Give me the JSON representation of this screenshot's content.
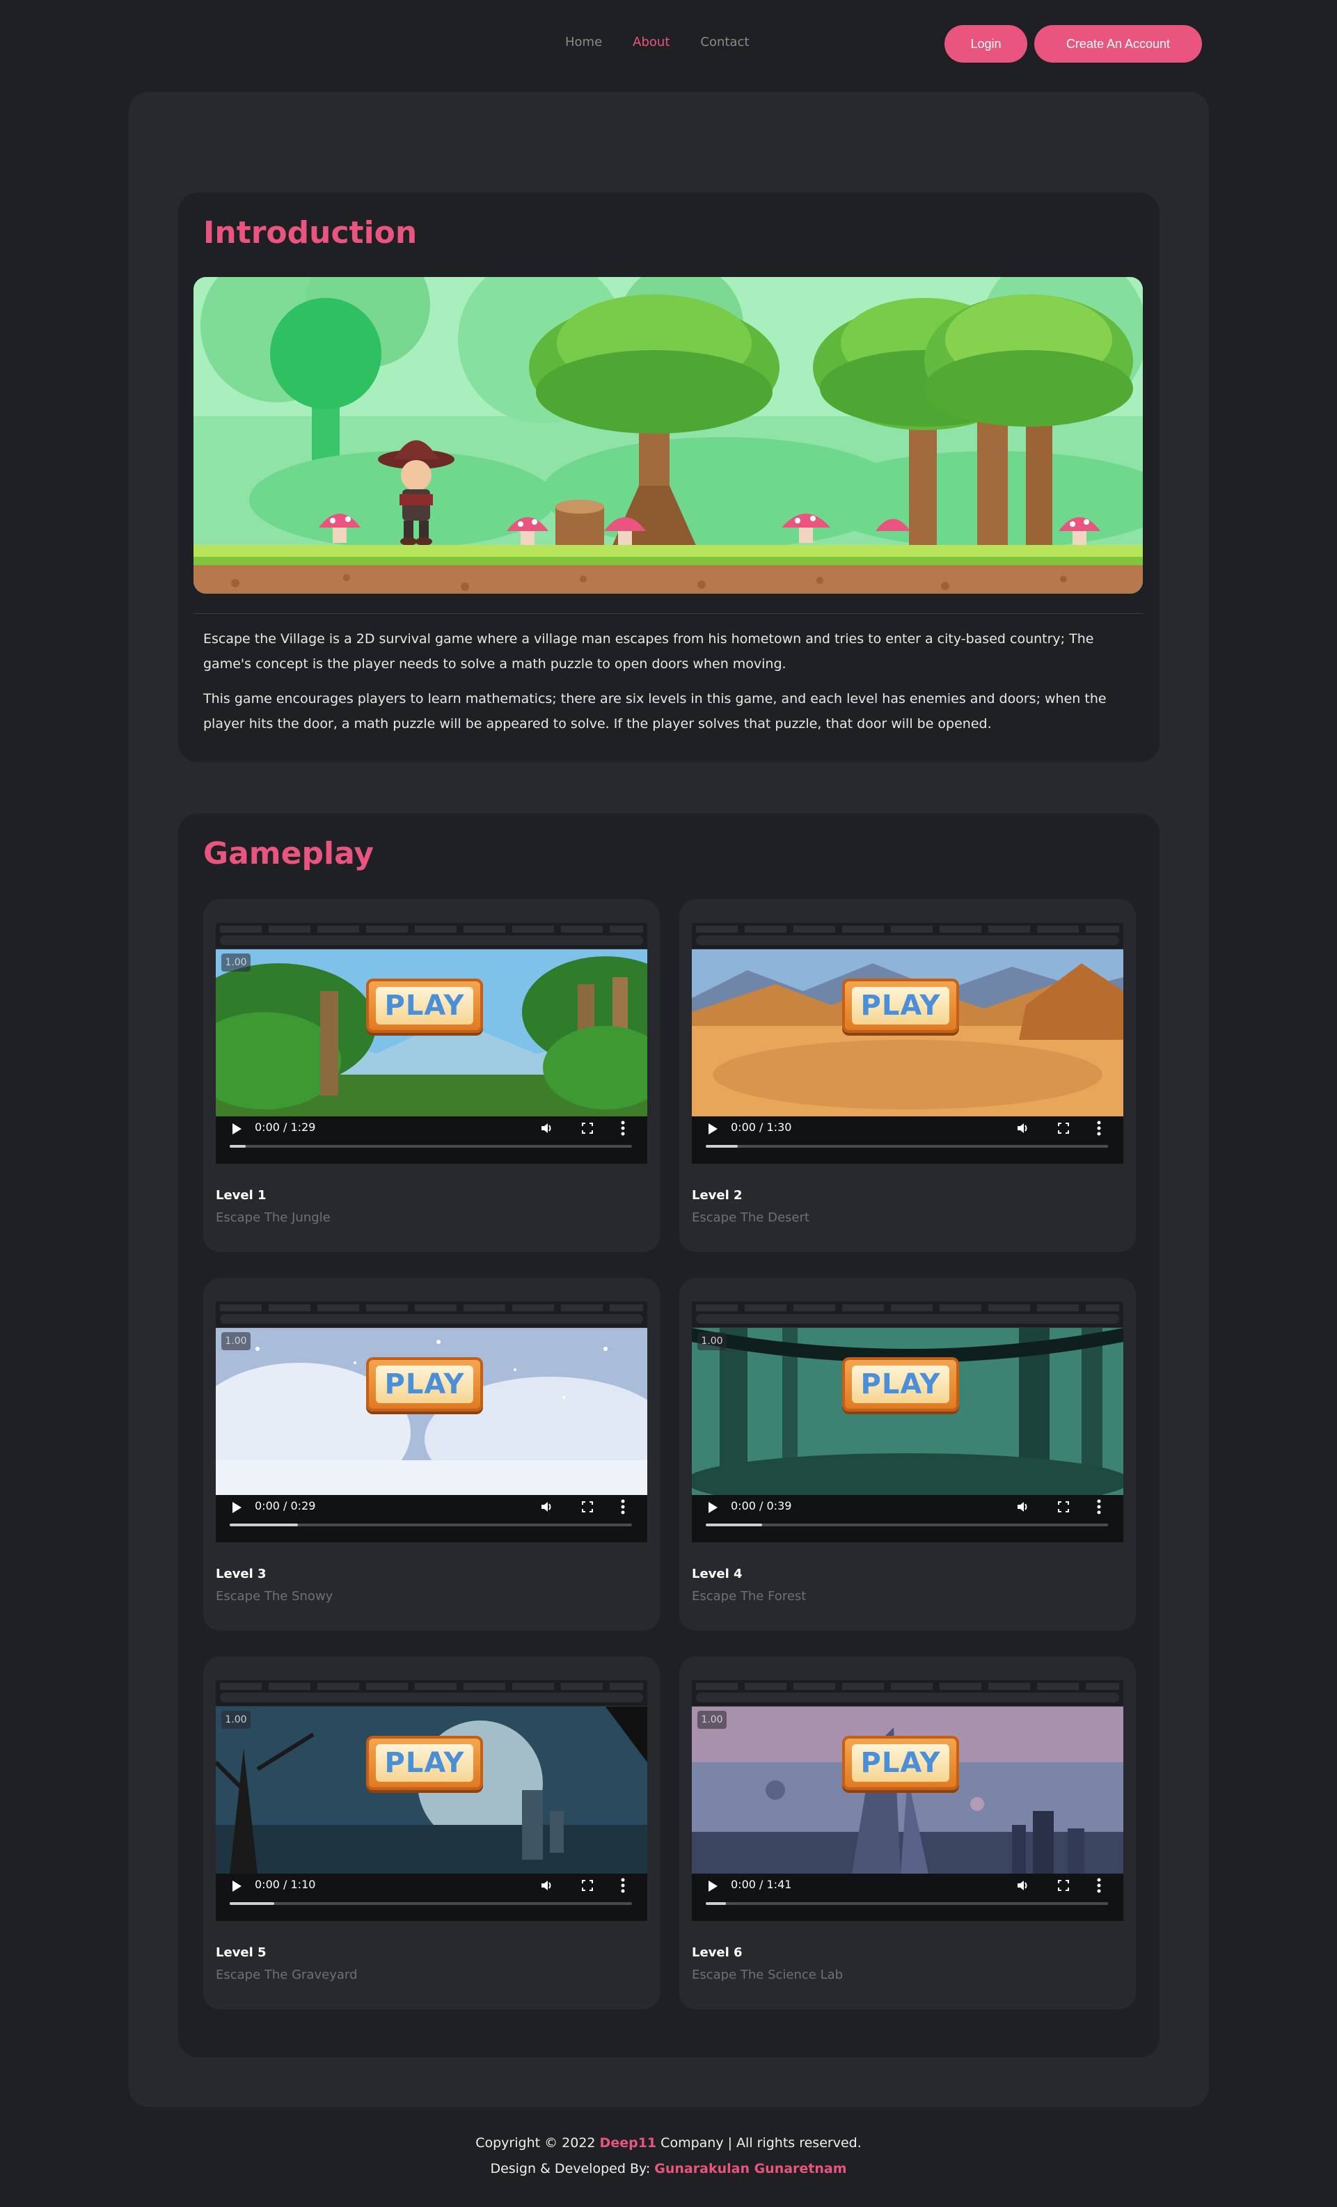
{
  "nav": {
    "links": [
      {
        "label": "Home",
        "active": false
      },
      {
        "label": "About",
        "active": true
      },
      {
        "label": "Contact",
        "active": false
      }
    ],
    "login_label": "Login",
    "create_label": "Create An Account"
  },
  "intro": {
    "title": "Introduction",
    "paragraph1": "Escape the Village is a 2D survival game where a village man escapes from his hometown and tries to enter a city-based country; The game's concept is the player needs to solve a math puzzle to open doors when moving.",
    "paragraph2": "This game encourages players to learn mathematics; there are six levels in this game, and each level has enemies and doors; when the player hits the door, a math puzzle will be appeared to solve. If the player solves that puzzle, that door will be opened."
  },
  "gameplay": {
    "title": "Gameplay",
    "play_sign": "PLAY",
    "levels": [
      {
        "level": "Level 1",
        "subtitle": "Escape The Jungle",
        "time": "0:00 / 1:29",
        "speed": "1.00",
        "progress": 0.04
      },
      {
        "level": "Level 2",
        "subtitle": "Escape The Desert",
        "time": "0:00 / 1:30",
        "speed": "",
        "progress": 0.08
      },
      {
        "level": "Level 3",
        "subtitle": "Escape The Snowy",
        "time": "0:00 / 0:29",
        "speed": "1.00",
        "progress": 0.17
      },
      {
        "level": "Level 4",
        "subtitle": "Escape The Forest",
        "time": "0:00 / 0:39",
        "speed": "1.00",
        "progress": 0.14
      },
      {
        "level": "Level 5",
        "subtitle": "Escape The Graveyard",
        "time": "0:00 / 1:10",
        "speed": "1.00",
        "progress": 0.11
      },
      {
        "level": "Level 6",
        "subtitle": "Escape The Science Lab",
        "time": "0:00 / 1:41",
        "speed": "1.00",
        "progress": 0.05
      }
    ]
  },
  "footer": {
    "copyright_prefix": "Copyright © 2022 ",
    "company_brand": "Deep11",
    "copyright_suffix": " Company | All rights reserved.",
    "designed_prefix": "Design & Developed By: ",
    "designer": "Gunarakulan Gunaretnam"
  },
  "colors": {
    "accent": "#e9557f",
    "page_bg": "#1f2023",
    "panel_bg": "#27292c"
  }
}
